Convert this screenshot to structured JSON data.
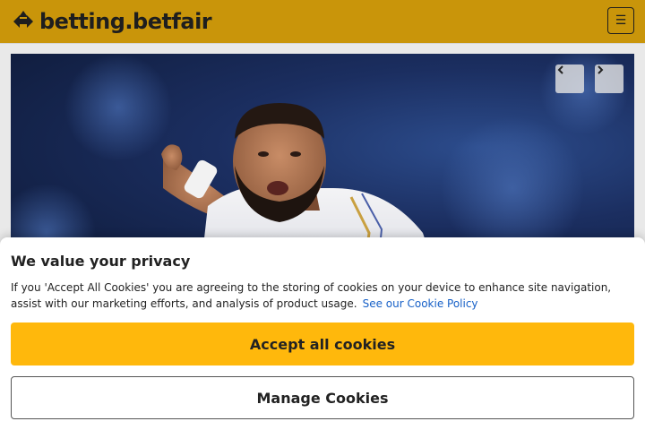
{
  "header": {
    "logo_text": "betting.betfair",
    "logo_icon": "betfair-arrows-logo",
    "menu_icon": "hamburger-menu-icon",
    "menu_glyph": "☰",
    "background_color": "#c9950a"
  },
  "hero": {
    "prev_icon": "chevron-left-icon",
    "next_icon": "chevron-right-icon"
  },
  "cookie_banner": {
    "title": "We value your privacy",
    "body": "If you 'Accept All Cookies' you are agreeing to the storing of cookies on your device to enhance site navigation, assist with our marketing efforts, and analysis of product usage.",
    "link_text": "See our Cookie Policy",
    "accept_label": "Accept all cookies",
    "manage_label": "Manage Cookies",
    "accept_color": "#ffb80c",
    "link_color": "#1660c7"
  }
}
